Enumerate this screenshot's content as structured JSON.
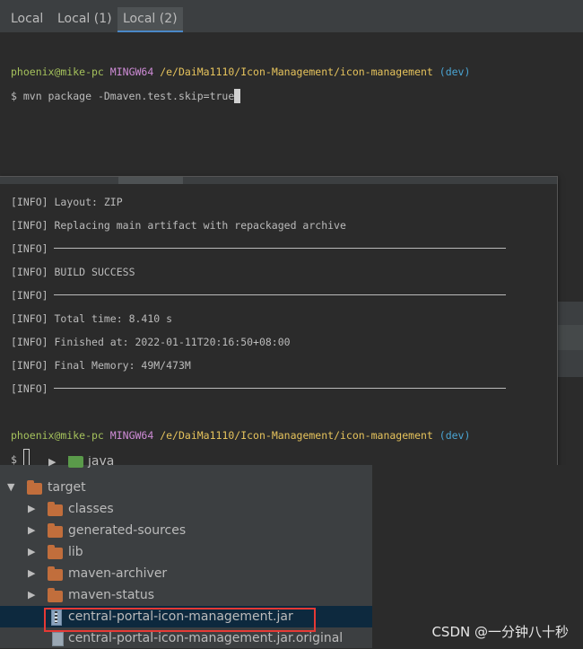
{
  "tabs": [
    {
      "label": "Local",
      "active": false
    },
    {
      "label": "Local (1)",
      "active": false
    },
    {
      "label": "Local (2)",
      "active": true
    }
  ],
  "top_terminal": {
    "prompt": {
      "user": "phoenix@mike-pc",
      "host": "MINGW64",
      "path": "/e/DaiMa1110/Icon-Management/icon-management",
      "branch": "(dev)"
    },
    "command_prefix": "$ ",
    "command": "mvn package -Dmaven.test.skip=true"
  },
  "overlay_terminal": {
    "lines": [
      {
        "tag": "[INFO]",
        "text": "Layout: ZIP"
      },
      {
        "tag": "[INFO]",
        "text": "Replacing main artifact with repackaged archive"
      },
      {
        "tag": "[INFO]",
        "text": "",
        "separator": true
      },
      {
        "tag": "[INFO]",
        "text": "BUILD SUCCESS"
      },
      {
        "tag": "[INFO]",
        "text": "",
        "separator": true
      },
      {
        "tag": "[INFO]",
        "text": "Total time: 8.410 s"
      },
      {
        "tag": "[INFO]",
        "text": "Finished at: 2022-01-11T20:16:50+08:00"
      },
      {
        "tag": "[INFO]",
        "text": "Final Memory: 49M/473M"
      },
      {
        "tag": "[INFO]",
        "text": "",
        "separator": true
      }
    ],
    "prompt": {
      "user": "phoenix@mike-pc",
      "host": "MINGW64",
      "path": "/e/DaiMa1110/Icon-Management/icon-management",
      "branch": "(dev)"
    },
    "command_prefix": "$ "
  },
  "project_tree": {
    "items": [
      {
        "label": "java",
        "icon": "folder-icon",
        "expanded": false
      },
      {
        "label": "target",
        "icon": "folder-icon",
        "expanded": true
      },
      {
        "label": "classes",
        "icon": "folder-icon",
        "expanded": false
      },
      {
        "label": "generated-sources",
        "icon": "folder-icon",
        "expanded": false
      },
      {
        "label": "lib",
        "icon": "folder-icon",
        "expanded": false
      },
      {
        "label": "maven-archiver",
        "icon": "folder-icon",
        "expanded": false
      },
      {
        "label": "maven-status",
        "icon": "folder-icon",
        "expanded": false
      },
      {
        "label": "central-portal-icon-management.jar",
        "icon": "jar-file-icon",
        "selected": true
      },
      {
        "label": "central-portal-icon-management.jar.original",
        "icon": "file-icon"
      }
    ]
  },
  "watermark": "CSDN @一分钟八十秒",
  "colors": {
    "selection": "#0d293e",
    "highlight_border": "#e53935",
    "folder": "#c16e3c"
  }
}
